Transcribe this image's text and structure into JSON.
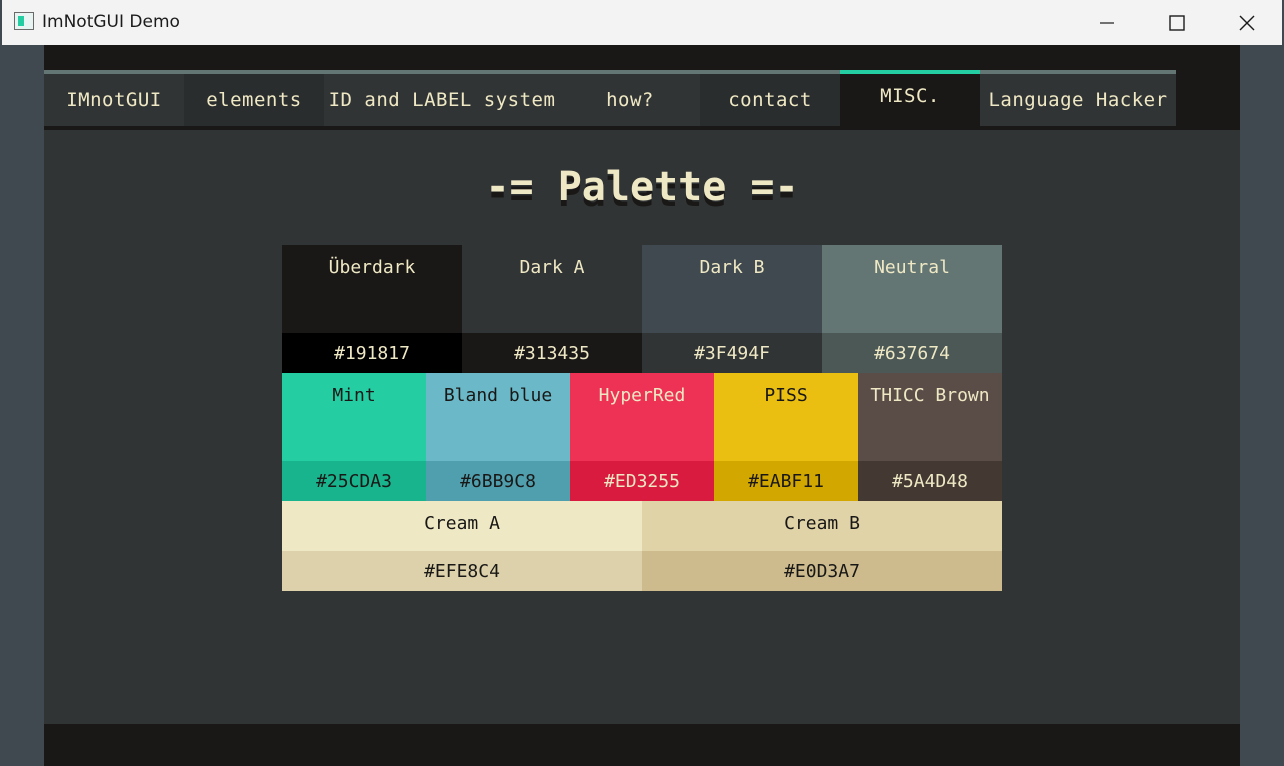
{
  "window": {
    "title": "ImNotGUI Demo",
    "controls": {
      "minimize": "minimize",
      "maximize": "maximize",
      "close": "close"
    }
  },
  "tabs": [
    {
      "label": "IMnotGUI",
      "active": false
    },
    {
      "label": "elements",
      "active": false
    },
    {
      "label": "ID and LABEL system",
      "active": false
    },
    {
      "label": "how?",
      "active": false
    },
    {
      "label": "contact",
      "active": false
    },
    {
      "label": "MISC.",
      "active": true
    },
    {
      "label": "Language Hacker",
      "active": false
    }
  ],
  "page": {
    "heading": "-= Palette =-"
  },
  "palette": {
    "row1": [
      {
        "name": "Überdark",
        "hex": "#191817",
        "color": "#191817",
        "hex_bg": "#000000",
        "text": "#efe8c4"
      },
      {
        "name": "Dark A",
        "hex": "#313435",
        "color": "#313435",
        "hex_bg": "#191817",
        "text": "#efe8c4"
      },
      {
        "name": "Dark B",
        "hex": "#3F494F",
        "color": "#3f494f",
        "hex_bg": "#313435",
        "text": "#efe8c4"
      },
      {
        "name": "Neutral",
        "hex": "#637674",
        "color": "#637674",
        "hex_bg": "#4b5856",
        "text": "#efe8c4"
      }
    ],
    "row2": [
      {
        "name": "Mint",
        "hex": "#25CDA3",
        "color": "#25cda3",
        "hex_bg": "#18b48d",
        "text": "#191817"
      },
      {
        "name": "Bland blue",
        "hex": "#6BB9C8",
        "color": "#6bb9c8",
        "hex_bg": "#509fae",
        "text": "#191817"
      },
      {
        "name": "HyperRed",
        "hex": "#ED3255",
        "color": "#ed3255",
        "hex_bg": "#d81b3e",
        "text": "#efe8c4"
      },
      {
        "name": "PISS",
        "hex": "#EABF11",
        "color": "#eabf11",
        "hex_bg": "#d2a700",
        "text": "#191817"
      },
      {
        "name": "THICC Brown",
        "hex": "#5A4D48",
        "color": "#5a4d48",
        "hex_bg": "#443833",
        "text": "#efe8c4"
      }
    ],
    "row3": [
      {
        "name": "Cream A",
        "hex": "#EFE8C4",
        "color": "#efe8c4",
        "hex_bg": "#dcd1aa",
        "text": "#191817"
      },
      {
        "name": "Cream B",
        "hex": "#E0D3A7",
        "color": "#e0d3a7",
        "hex_bg": "#cdbb8e",
        "text": "#191817"
      }
    ]
  }
}
